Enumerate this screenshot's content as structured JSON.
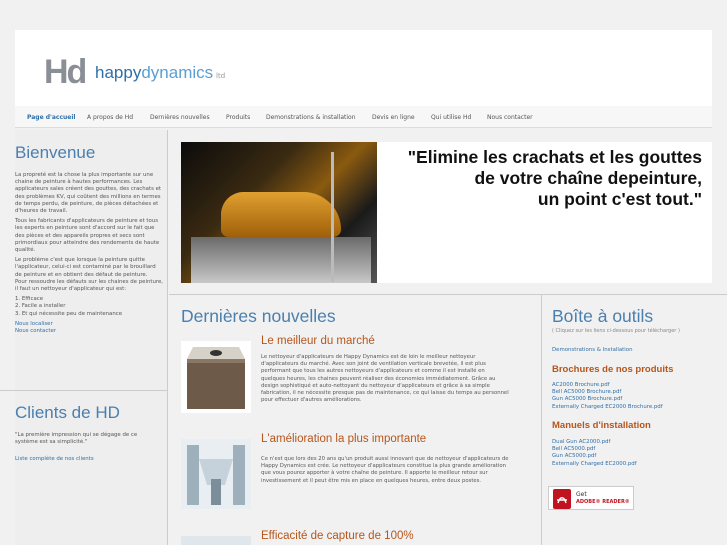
{
  "header": {
    "logo_mark": "Hd",
    "logo_word_a": "happy",
    "logo_word_b": "dynamics",
    "logo_suffix": "ltd"
  },
  "nav": [
    {
      "label": "Page d'accueil",
      "active": true
    },
    {
      "label": "A propos de Hd"
    },
    {
      "label": "Dernières nouvelles"
    },
    {
      "label": "Produits"
    },
    {
      "label": "Demonstrations & installation"
    },
    {
      "label": "Devis en ligne"
    },
    {
      "label": "Qui utilise Hd"
    },
    {
      "label": "Nous contacter"
    }
  ],
  "welcome": {
    "title": "Bienvenue",
    "p1": "La propreté est la chose la plus importante sur une chaine de peinture à hautes performances. Les applicateurs sales créent des gouttes, des crachats et des problèmes KV, qui coûtent des millions en termes de temps perdu, de peinture, de pièces détachées et d'heures de travail.",
    "p2": "Tous les fabricants d'applicateurs de peinture et tous les experts en peinture sont d'accord sur le fait que des pièces et des appareils propres et secs sont primordiaux pour atteindre des rendements de haute qualité.",
    "p3": "Le problème c'est que lorsque la peinture quitte l'applicateur, celui-ci est contaminé par le brouillard de peinture et en obtient des défaut de peinture.",
    "p4": "Pour ressoudre les défauts sur les chaines de peinture, il faut un nettoyeur d'applicateur qui est:",
    "list": [
      "1. Efficace",
      "2. Facile a installer",
      "3. Et qui nécessite peu de maintenance"
    ],
    "links": [
      "Nous localiser",
      "Nous contacter"
    ]
  },
  "clients": {
    "title": "Clients de HD",
    "quote": "\"La première impression qui se dégage de ce système est sa simplicité.\"",
    "link": "Liste complète de nos clients"
  },
  "banner": {
    "line1": "\"Elimine les crachats et les gouttes",
    "line2": "de votre chaîne depeinture,",
    "line3": "un point c'est tout.\""
  },
  "news": {
    "title": "Dernières nouvelles",
    "items": [
      {
        "title": "Le meilleur du marché",
        "text": "Le nettoyeur d'applicateurs de Happy Dynamics est de loin le meilleur nettoyeur d'applicateurs du marché. Avec son joint de ventilation verticale brevetée, il est plus performant que tous les autres nettoyeurs d'applicateurs et comme il est installé en quelques heures, les chaines peuvent réaliser des économies immédiatement. Grâce au design sophistiqué et auto-nettoyant du nettoyeur d'applicateurs et grâce à sa simple fabrication, il ne nécessite presque pas de maintenance, ce qui laisse du temps au personnel pour effectuer d'autres améliorations."
      },
      {
        "title": "L'amélioration la plus importante",
        "text": "Ce n'est que lors des 20 ans qu'un produit aussi innovant que de nettoyeur d'applicateurs de Happy Dynamics est crée. Le nettoyeur d'applicateurs constitue la plus grande amélioration que vous pourez apporter à votre chaîne de peinture. Il apporte le meilleur retour sur investissement et il peut être mis en place en quelques heures, entre deux postes."
      },
      {
        "title": "Efficacité de capture de 100%",
        "text": ""
      }
    ]
  },
  "toolbox": {
    "title": "Boîte à outils",
    "hint": "( Cliquez sur les liens ci-dessous pour télécharger )",
    "demo_link": "Demonstrations & Installation",
    "brochures_title": "Brochures de nos produits",
    "brochures": [
      "AC2000 Brochure.pdf",
      "Bell AC5000 Brochure.pdf",
      "Gun AC5000 Brochure.pdf",
      "Externally Charged EC2000 Brochure.pdf"
    ],
    "manuals_title": "Manuels d'installation",
    "manuals": [
      "Dual Gun AC2000.pdf",
      "Bell AC5000.pdf",
      "Gun AC5000.pdf",
      "Externally Charged EC2000.pdf"
    ],
    "adobe_get": "Get",
    "adobe_label": "ADOBE® READER®"
  }
}
